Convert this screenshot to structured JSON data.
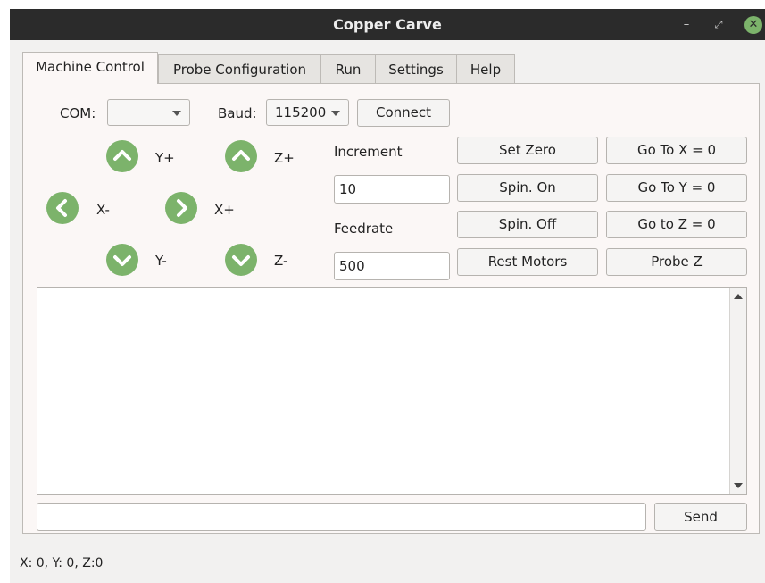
{
  "window": {
    "title": "Copper Carve",
    "controls": [
      "minimize-icon",
      "maximize-icon",
      "close-icon"
    ]
  },
  "tabs": [
    {
      "label": "Machine Control",
      "active": true
    },
    {
      "label": "Probe Configuration",
      "active": false
    },
    {
      "label": "Run",
      "active": false
    },
    {
      "label": "Settings",
      "active": false
    },
    {
      "label": "Help",
      "active": false
    }
  ],
  "connection": {
    "com_label": "COM:",
    "com_value": "",
    "baud_label": "Baud:",
    "baud_value": "115200",
    "connect_label": "Connect"
  },
  "jog": {
    "y_plus": "Y+",
    "y_minus": "Y-",
    "x_plus": "X+",
    "x_minus": "X-",
    "z_plus": "Z+",
    "z_minus": "Z-"
  },
  "motion": {
    "increment_label": "Increment",
    "increment_value": "10",
    "feedrate_label": "Feedrate",
    "feedrate_value": "500"
  },
  "actions": {
    "set_zero": "Set Zero",
    "spin_on": "Spin. On",
    "spin_off": "Spin. Off",
    "rest_motors": "Rest Motors",
    "goto_x": "Go To X = 0",
    "goto_y": "Go To Y = 0",
    "goto_z": "Go to Z = 0",
    "probe_z": "Probe Z"
  },
  "console": {
    "output": "",
    "command_value": "",
    "send_label": "Send"
  },
  "statusbar": {
    "position": "X: 0, Y: 0, Z:0"
  },
  "colors": {
    "jog_button": "#7cb36b",
    "titlebar": "#2b2b2b"
  }
}
